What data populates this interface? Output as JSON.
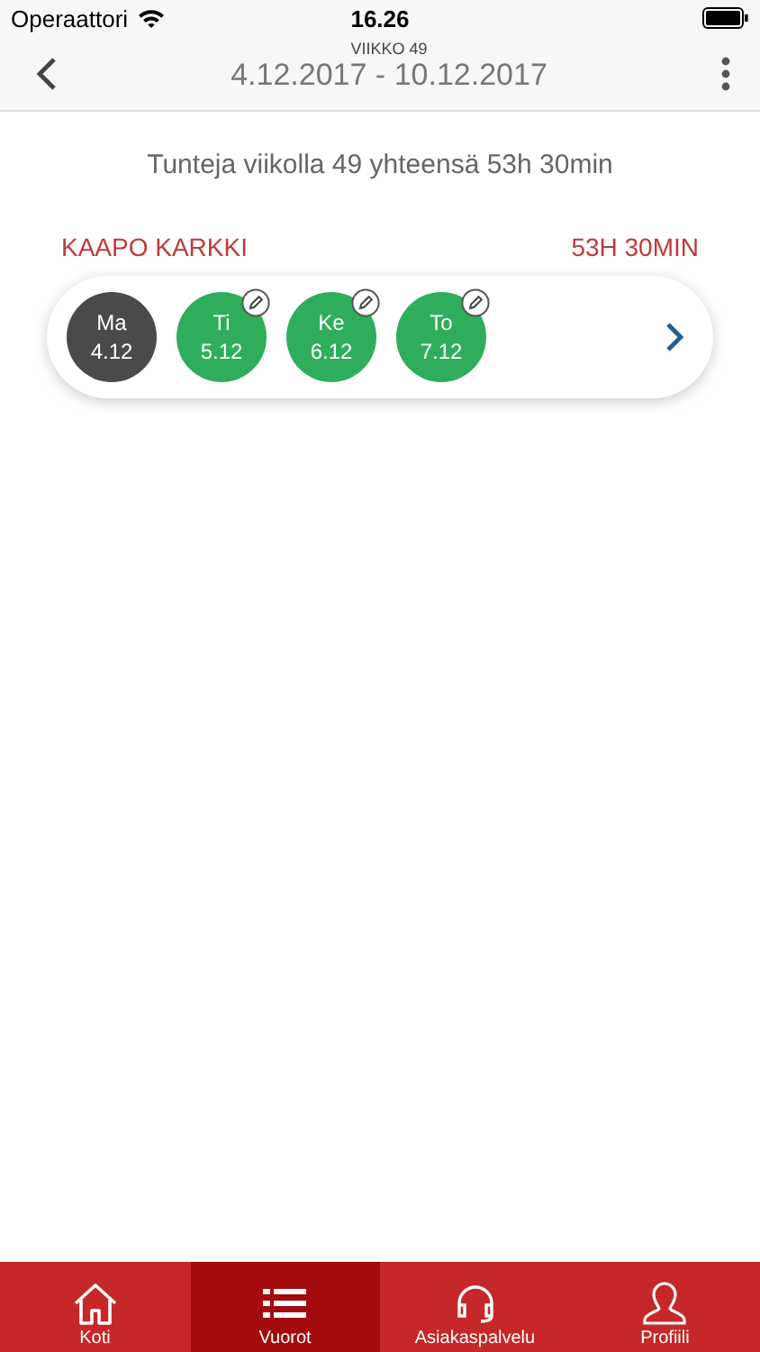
{
  "status_bar": {
    "carrier": "Operaattori",
    "time": "16.26"
  },
  "header": {
    "week": "VIIKKO 49",
    "range": "4.12.2017 - 10.12.2017"
  },
  "summary": "Tunteja viikolla 49 yhteensä 53h 30min",
  "employee": {
    "name": "KAAPO KARKKI",
    "total": "53H 30MIN"
  },
  "days": [
    {
      "day": "Ma",
      "date": "4.12",
      "editable": false
    },
    {
      "day": "Ti",
      "date": "5.12",
      "editable": true
    },
    {
      "day": "Ke",
      "date": "6.12",
      "editable": true
    },
    {
      "day": "To",
      "date": "7.12",
      "editable": true
    }
  ],
  "tabs": [
    {
      "label": "Koti",
      "kind": "home",
      "selected": false
    },
    {
      "label": "Vuorot",
      "kind": "list",
      "selected": true
    },
    {
      "label": "Asiakaspalvelu",
      "kind": "support",
      "selected": false
    },
    {
      "label": "Profiili",
      "kind": "profile",
      "selected": false
    }
  ]
}
